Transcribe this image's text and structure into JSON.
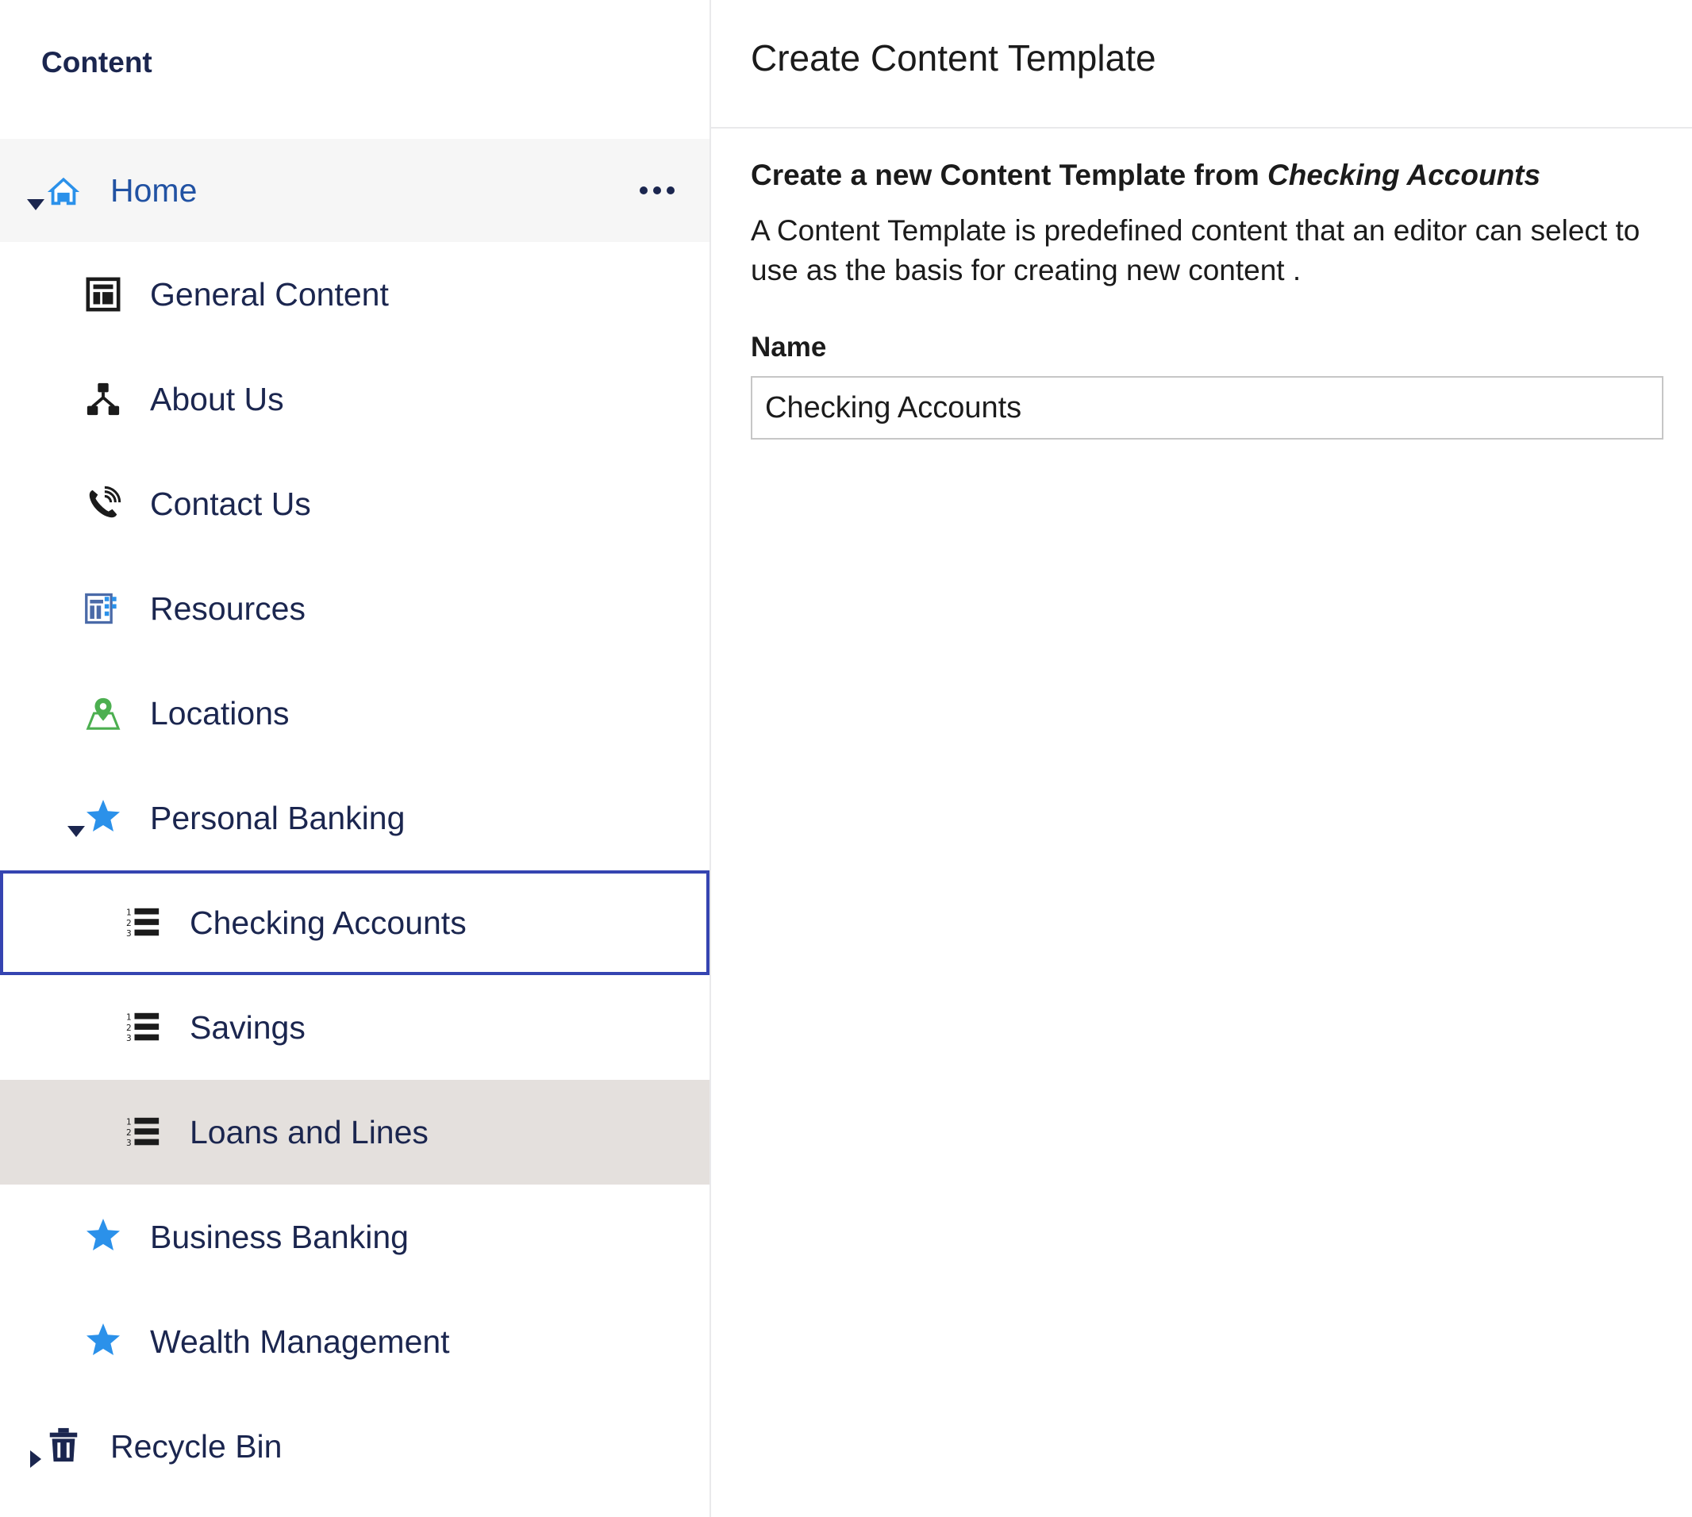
{
  "sidebar": {
    "section_title": "Content",
    "more_label": "...",
    "items": [
      {
        "label": "Home"
      },
      {
        "label": "General Content"
      },
      {
        "label": "About Us"
      },
      {
        "label": "Contact Us"
      },
      {
        "label": "Resources"
      },
      {
        "label": "Locations"
      },
      {
        "label": "Personal Banking"
      },
      {
        "label": "Checking Accounts"
      },
      {
        "label": "Savings"
      },
      {
        "label": "Loans and Lines"
      },
      {
        "label": "Business Banking"
      },
      {
        "label": "Wealth Management"
      },
      {
        "label": "Recycle Bin"
      }
    ]
  },
  "panel": {
    "title": "Create Content Template",
    "subhead_prefix": "Create a new Content Template from ",
    "subhead_source": "Checking Accounts",
    "description": "A Content Template is predefined content that an editor can select to use as the basis for creating new content .",
    "name_label": "Name",
    "name_value": "Checking Accounts"
  },
  "colors": {
    "nav_text": "#1b264f",
    "home_text": "#2152a3",
    "selected_outline": "#3544b1",
    "hover_bg": "#e4e0dd",
    "star": "#2b91ea",
    "location_pin": "#4caf50"
  },
  "icons": {
    "home": "home-icon",
    "general_content": "layout-icon",
    "about_us": "sitemap-icon",
    "contact_us": "phone-icon",
    "resources": "resources-icon",
    "locations": "map-pin-icon",
    "personal_banking": "star-icon",
    "checking_accounts": "ordered-list-icon",
    "savings": "ordered-list-icon",
    "loans_and_lines": "ordered-list-icon",
    "business_banking": "star-icon",
    "wealth_management": "star-icon",
    "recycle_bin": "trash-icon"
  }
}
